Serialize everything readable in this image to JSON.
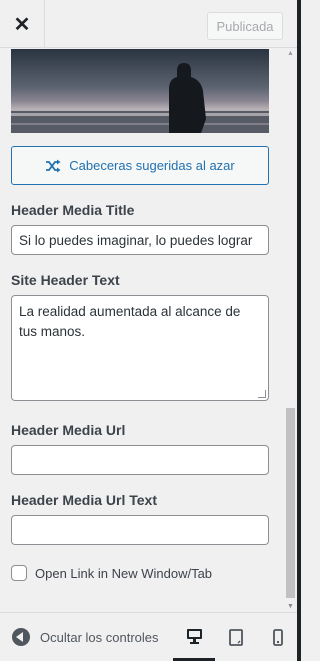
{
  "topbar": {
    "close_icon": "close-icon",
    "publish_label": "Publicada"
  },
  "media": {
    "header_image": "header-image-person-at-sea",
    "random_button_label": "Cabeceras sugeridas al azar",
    "random_button_icon": "shuffle-icon"
  },
  "fields": {
    "header_media_title": {
      "label": "Header Media Title",
      "value": "Si lo puedes imaginar, lo puedes lograr"
    },
    "site_header_text": {
      "label": "Site Header Text",
      "value": "La realidad aumentada al alcance de tus manos."
    },
    "header_media_url": {
      "label": "Header Media Url",
      "value": ""
    },
    "header_media_url_text": {
      "label": "Header Media Url Text",
      "value": ""
    },
    "open_new_window": {
      "label": "Open Link in New Window/Tab",
      "checked": false
    }
  },
  "footer": {
    "hide_controls_label": "Ocultar los controles",
    "devices": [
      "desktop-icon",
      "tablet-icon",
      "mobile-icon"
    ],
    "active_device": "desktop-icon"
  },
  "colors": {
    "accent": "#2271b1",
    "background": "#f0f0f1",
    "text": "#1d2327"
  }
}
